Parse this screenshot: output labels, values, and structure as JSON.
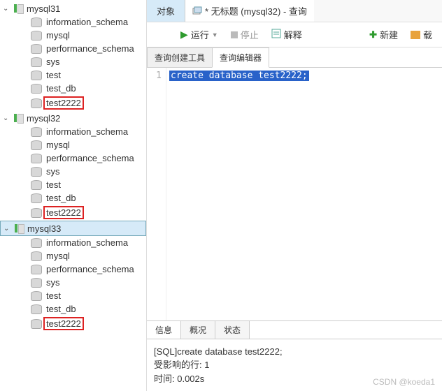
{
  "sidebar": {
    "servers": [
      {
        "name": "mysql31",
        "expanded": true,
        "highlighted": false,
        "databases": [
          "information_schema",
          "mysql",
          "performance_schema",
          "sys",
          "test",
          "test_db",
          "test2222"
        ],
        "boxed": [
          "test2222"
        ]
      },
      {
        "name": "mysql32",
        "expanded": true,
        "highlighted": false,
        "databases": [
          "information_schema",
          "mysql",
          "performance_schema",
          "sys",
          "test",
          "test_db",
          "test2222"
        ],
        "boxed": [
          "test2222"
        ]
      },
      {
        "name": "mysql33",
        "expanded": true,
        "highlighted": true,
        "databases": [
          "information_schema",
          "mysql",
          "performance_schema",
          "sys",
          "test",
          "test_db",
          "test2222"
        ],
        "boxed": [
          "test2222"
        ]
      }
    ]
  },
  "tabs": {
    "object": "对象",
    "query_title": "* 无标题 (mysql32) - 查询"
  },
  "toolbar": {
    "run": "运行",
    "stop": "停止",
    "explain": "解释",
    "new": "新建",
    "load": "载"
  },
  "subtabs": {
    "builder": "查询创建工具",
    "editor": "查询编辑器"
  },
  "editor": {
    "line_no": "1",
    "code": "create database test2222;"
  },
  "bottom_tabs": {
    "info": "信息",
    "summary": "概况",
    "status": "状态"
  },
  "result": {
    "sql_line": "[SQL]create database test2222;",
    "rows": "受影响的行: 1",
    "time": "时间: 0.002s"
  },
  "watermark": "CSDN @koeda1"
}
